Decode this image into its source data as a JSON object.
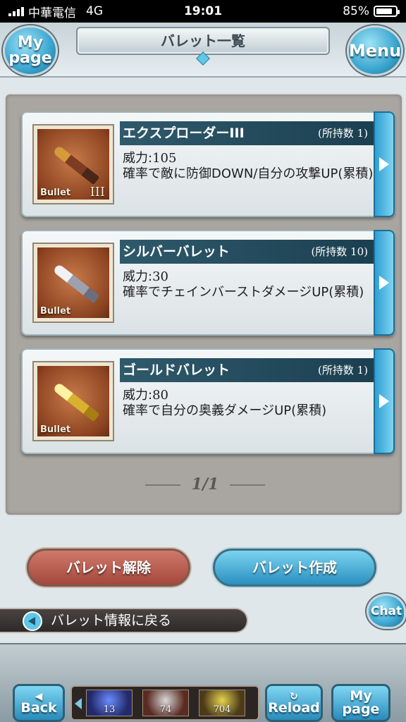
{
  "status_bar": {
    "carrier": "中華電信",
    "network": "4G",
    "time": "19:01",
    "battery_percent": "85%",
    "battery_level": 0.85
  },
  "header": {
    "title": "バレット一覧",
    "mypage_label_line1": "My",
    "mypage_label_line2": "page",
    "menu_label": "Menu"
  },
  "bullets": [
    {
      "name": "エクスプローダーIII",
      "owned": "(所持数 1)",
      "power_label": "威力:",
      "power_value": "105",
      "effect": "確率で敵に防御DOWN/自分の攻撃UP(累積)",
      "thumb_label": "Bullet",
      "thumb_rank": "III",
      "icon": "explode-bullet-icon"
    },
    {
      "name": "シルバーバレット",
      "owned": "(所持数 10)",
      "power_label": "威力:",
      "power_value": "30",
      "effect": "確率でチェインバーストダメージUP(累積)",
      "thumb_label": "Bullet",
      "thumb_rank": "",
      "icon": "silver-bullet-icon"
    },
    {
      "name": "ゴールドバレット",
      "owned": "(所持数 1)",
      "power_label": "威力:",
      "power_value": "80",
      "effect": "確率で自分の奥義ダメージUP(累積)",
      "thumb_label": "Bullet",
      "thumb_rank": "",
      "icon": "gold-bullet-icon"
    }
  ],
  "pager": {
    "text": "1/1"
  },
  "actions": {
    "release_label": "バレット解除",
    "create_label": "バレット作成"
  },
  "back_link": {
    "label": "バレット情報に戻る"
  },
  "chat": {
    "label": "Chat"
  },
  "bottom_nav": {
    "back_label": "Back",
    "reload_label": "Reload",
    "mypage_line1": "My",
    "mypage_line2": "page",
    "items": [
      {
        "count": "13",
        "icon": "crystal-icon"
      },
      {
        "count": "74",
        "icon": "ticket-icon"
      },
      {
        "count": "704",
        "icon": "gold-moon-icon"
      }
    ]
  }
}
